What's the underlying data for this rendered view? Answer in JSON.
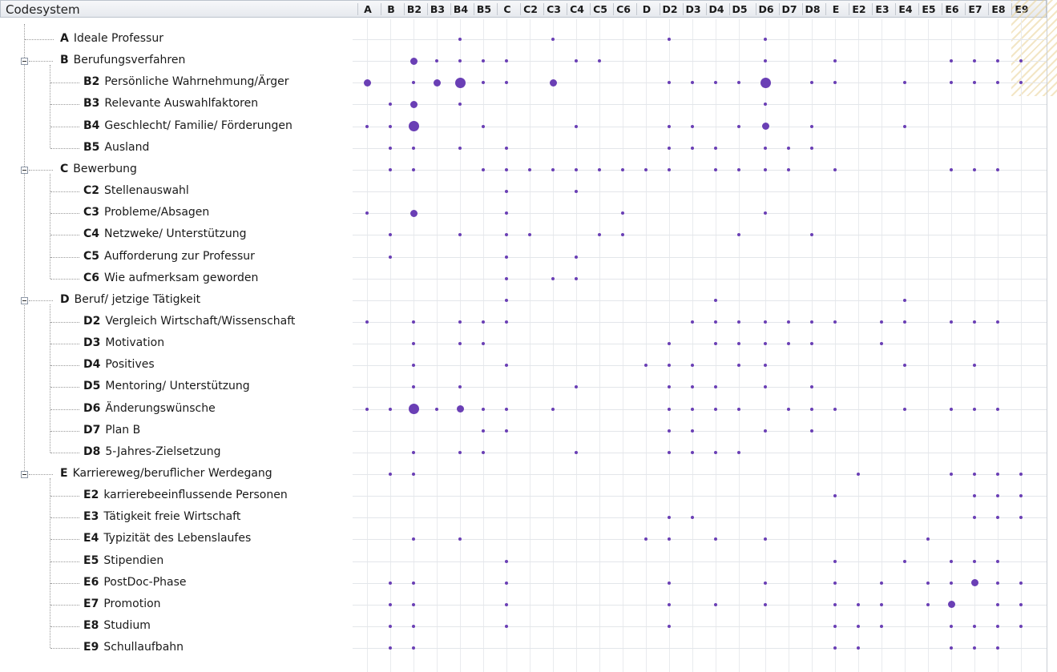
{
  "header": {
    "title": "Codesystem"
  },
  "columns": [
    "A",
    "B",
    "B2",
    "B3",
    "B4",
    "B5",
    "C",
    "C2",
    "C3",
    "C4",
    "C5",
    "C6",
    "D",
    "D2",
    "D3",
    "D4",
    "D5",
    "D6",
    "D7",
    "D8",
    "E",
    "E2",
    "E3",
    "E4",
    "E5",
    "E6",
    "E7",
    "E8",
    "E9"
  ],
  "rows": [
    {
      "code": "A",
      "label": "Ideale Professur",
      "level": 0,
      "expandable": false
    },
    {
      "code": "B",
      "label": "Berufungsverfahren",
      "level": 0,
      "expandable": true
    },
    {
      "code": "B2",
      "label": "Persönliche Wahrnehmung/Ärger",
      "level": 1
    },
    {
      "code": "B3",
      "label": "Relevante Auswahlfaktoren",
      "level": 1
    },
    {
      "code": "B4",
      "label": "Geschlecht/ Familie/ Förderungen",
      "level": 1
    },
    {
      "code": "B5",
      "label": "Ausland",
      "level": 1
    },
    {
      "code": "C",
      "label": "Bewerbung",
      "level": 0,
      "expandable": true
    },
    {
      "code": "C2",
      "label": "Stellenauswahl",
      "level": 1
    },
    {
      "code": "C3",
      "label": "Probleme/Absagen",
      "level": 1
    },
    {
      "code": "C4",
      "label": "Netzweke/ Unterstützung",
      "level": 1
    },
    {
      "code": "C5",
      "label": "Aufforderung zur Professur",
      "level": 1
    },
    {
      "code": "C6",
      "label": "Wie aufmerksam geworden",
      "level": 1
    },
    {
      "code": "D",
      "label": "Beruf/ jetzige Tätigkeit",
      "level": 0,
      "expandable": true
    },
    {
      "code": "D2",
      "label": "Vergleich Wirtschaft/Wissenschaft",
      "level": 1
    },
    {
      "code": "D3",
      "label": "Motivation",
      "level": 1
    },
    {
      "code": "D4",
      "label": "Positives",
      "level": 1
    },
    {
      "code": "D5",
      "label": "Mentoring/ Unterstützung",
      "level": 1
    },
    {
      "code": "D6",
      "label": "Änderungswünsche",
      "level": 1
    },
    {
      "code": "D7",
      "label": "Plan B",
      "level": 1
    },
    {
      "code": "D8",
      "label": "5-Jahres-Zielsetzung",
      "level": 1
    },
    {
      "code": "E",
      "label": "Karriereweg/beruflicher Werdegang",
      "level": 0,
      "expandable": true
    },
    {
      "code": "E2",
      "label": "karrierebeeinflussende  Personen",
      "level": 1
    },
    {
      "code": "E3",
      "label": "Tätigkeit freie Wirtschaft",
      "level": 1
    },
    {
      "code": "E4",
      "label": "Typizität des Lebenslaufes",
      "level": 1
    },
    {
      "code": "E5",
      "label": "Stipendien",
      "level": 1
    },
    {
      "code": "E6",
      "label": "PostDoc-Phase",
      "level": 1
    },
    {
      "code": "E7",
      "label": "Promotion",
      "level": 1
    },
    {
      "code": "E8",
      "label": "Studium",
      "level": 1
    },
    {
      "code": "E9",
      "label": "Schullaufbahn",
      "level": 1
    }
  ],
  "matrix": [
    [
      0,
      0,
      0,
      0,
      1,
      0,
      0,
      0,
      1,
      0,
      0,
      0,
      0,
      1,
      0,
      0,
      0,
      1,
      0,
      0,
      0,
      0,
      0,
      0,
      0,
      0,
      0,
      0,
      0
    ],
    [
      0,
      0,
      2,
      1,
      1,
      1,
      1,
      0,
      0,
      1,
      1,
      0,
      0,
      0,
      0,
      0,
      0,
      1,
      0,
      0,
      1,
      0,
      0,
      0,
      0,
      1,
      1,
      1,
      1
    ],
    [
      2,
      0,
      1,
      2,
      3,
      1,
      1,
      0,
      2,
      0,
      0,
      0,
      0,
      1,
      1,
      1,
      1,
      3,
      0,
      1,
      1,
      0,
      0,
      1,
      0,
      1,
      1,
      1,
      1
    ],
    [
      0,
      1,
      2,
      0,
      1,
      0,
      0,
      0,
      0,
      0,
      0,
      0,
      0,
      0,
      0,
      0,
      0,
      1,
      0,
      0,
      0,
      0,
      0,
      0,
      0,
      0,
      0,
      0,
      0
    ],
    [
      1,
      1,
      3,
      0,
      0,
      1,
      0,
      0,
      0,
      1,
      0,
      0,
      0,
      1,
      1,
      0,
      1,
      2,
      0,
      1,
      0,
      0,
      0,
      1,
      0,
      0,
      0,
      0,
      0
    ],
    [
      0,
      1,
      1,
      0,
      1,
      0,
      1,
      0,
      0,
      0,
      0,
      0,
      0,
      1,
      1,
      1,
      0,
      1,
      1,
      1,
      0,
      0,
      0,
      0,
      0,
      0,
      0,
      0,
      0
    ],
    [
      0,
      1,
      1,
      0,
      0,
      1,
      1,
      1,
      1,
      1,
      1,
      1,
      1,
      1,
      0,
      1,
      1,
      1,
      1,
      0,
      1,
      0,
      0,
      0,
      0,
      1,
      1,
      1,
      0
    ],
    [
      0,
      0,
      0,
      0,
      0,
      0,
      1,
      0,
      0,
      1,
      0,
      0,
      0,
      0,
      0,
      0,
      0,
      0,
      0,
      0,
      0,
      0,
      0,
      0,
      0,
      0,
      0,
      0,
      0
    ],
    [
      1,
      0,
      2,
      0,
      0,
      0,
      1,
      0,
      0,
      0,
      0,
      1,
      0,
      0,
      0,
      0,
      0,
      1,
      0,
      0,
      0,
      0,
      0,
      0,
      0,
      0,
      0,
      0,
      0
    ],
    [
      0,
      1,
      0,
      0,
      1,
      0,
      1,
      1,
      0,
      0,
      1,
      1,
      0,
      0,
      0,
      0,
      1,
      0,
      0,
      1,
      0,
      0,
      0,
      0,
      0,
      0,
      0,
      0,
      0
    ],
    [
      0,
      1,
      0,
      0,
      0,
      0,
      1,
      0,
      0,
      1,
      0,
      0,
      0,
      0,
      0,
      0,
      0,
      0,
      0,
      0,
      0,
      0,
      0,
      0,
      0,
      0,
      0,
      0,
      0
    ],
    [
      0,
      0,
      0,
      0,
      0,
      0,
      1,
      0,
      1,
      1,
      0,
      0,
      0,
      0,
      0,
      0,
      0,
      0,
      0,
      0,
      0,
      0,
      0,
      0,
      0,
      0,
      0,
      0,
      0
    ],
    [
      0,
      0,
      0,
      0,
      0,
      0,
      1,
      0,
      0,
      0,
      0,
      0,
      0,
      0,
      0,
      1,
      0,
      0,
      0,
      0,
      0,
      0,
      0,
      1,
      0,
      0,
      0,
      0,
      0
    ],
    [
      1,
      0,
      1,
      0,
      1,
      1,
      1,
      0,
      0,
      0,
      0,
      0,
      0,
      0,
      1,
      1,
      1,
      1,
      1,
      1,
      1,
      0,
      1,
      1,
      0,
      1,
      1,
      1,
      0
    ],
    [
      0,
      0,
      1,
      0,
      1,
      1,
      0,
      0,
      0,
      0,
      0,
      0,
      0,
      1,
      0,
      1,
      1,
      1,
      1,
      1,
      0,
      0,
      1,
      0,
      0,
      0,
      0,
      0,
      0
    ],
    [
      0,
      0,
      1,
      0,
      0,
      0,
      1,
      0,
      0,
      0,
      0,
      0,
      1,
      1,
      1,
      0,
      1,
      1,
      0,
      0,
      0,
      0,
      0,
      1,
      0,
      0,
      1,
      0,
      0
    ],
    [
      0,
      0,
      1,
      0,
      1,
      0,
      0,
      0,
      0,
      1,
      0,
      0,
      0,
      1,
      1,
      1,
      0,
      1,
      0,
      1,
      0,
      0,
      0,
      0,
      0,
      0,
      0,
      0,
      0
    ],
    [
      1,
      1,
      3,
      1,
      2,
      1,
      1,
      0,
      1,
      0,
      0,
      0,
      0,
      1,
      1,
      1,
      1,
      0,
      1,
      1,
      1,
      0,
      0,
      1,
      0,
      1,
      1,
      1,
      0
    ],
    [
      0,
      0,
      0,
      0,
      0,
      1,
      1,
      0,
      0,
      0,
      0,
      0,
      0,
      1,
      1,
      0,
      0,
      1,
      0,
      1,
      0,
      0,
      0,
      0,
      0,
      0,
      0,
      0,
      0
    ],
    [
      0,
      0,
      1,
      0,
      1,
      1,
      0,
      0,
      0,
      1,
      0,
      0,
      0,
      1,
      1,
      1,
      1,
      0,
      0,
      0,
      0,
      0,
      0,
      0,
      0,
      0,
      0,
      0,
      0
    ],
    [
      0,
      1,
      1,
      0,
      0,
      0,
      0,
      0,
      0,
      0,
      0,
      0,
      0,
      0,
      0,
      0,
      0,
      0,
      0,
      0,
      0,
      1,
      0,
      0,
      0,
      1,
      1,
      1,
      1
    ],
    [
      0,
      0,
      0,
      0,
      0,
      0,
      0,
      0,
      0,
      0,
      0,
      0,
      0,
      0,
      0,
      0,
      0,
      0,
      0,
      0,
      1,
      0,
      0,
      0,
      0,
      0,
      1,
      1,
      1
    ],
    [
      0,
      0,
      0,
      0,
      0,
      0,
      0,
      0,
      0,
      0,
      0,
      0,
      0,
      1,
      1,
      0,
      0,
      0,
      0,
      0,
      0,
      0,
      0,
      0,
      0,
      0,
      1,
      1,
      1
    ],
    [
      0,
      0,
      1,
      0,
      1,
      0,
      0,
      0,
      0,
      0,
      0,
      0,
      1,
      1,
      0,
      1,
      0,
      1,
      0,
      0,
      0,
      0,
      0,
      0,
      1,
      0,
      0,
      0,
      0
    ],
    [
      0,
      0,
      0,
      0,
      0,
      0,
      1,
      0,
      0,
      0,
      0,
      0,
      0,
      0,
      0,
      0,
      0,
      0,
      0,
      0,
      1,
      0,
      0,
      1,
      0,
      1,
      1,
      1,
      0
    ],
    [
      0,
      1,
      1,
      0,
      0,
      0,
      1,
      0,
      0,
      0,
      0,
      0,
      0,
      1,
      0,
      0,
      0,
      1,
      0,
      0,
      1,
      0,
      1,
      0,
      1,
      1,
      2,
      1,
      1
    ],
    [
      0,
      1,
      1,
      0,
      0,
      0,
      1,
      0,
      0,
      0,
      0,
      0,
      0,
      1,
      0,
      1,
      0,
      1,
      0,
      0,
      1,
      1,
      1,
      0,
      1,
      2,
      0,
      1,
      1
    ],
    [
      0,
      1,
      1,
      0,
      0,
      0,
      1,
      0,
      0,
      0,
      0,
      0,
      0,
      1,
      0,
      0,
      0,
      0,
      0,
      0,
      1,
      1,
      1,
      0,
      0,
      1,
      1,
      1,
      1
    ],
    [
      0,
      1,
      1,
      0,
      0,
      0,
      0,
      0,
      0,
      0,
      0,
      0,
      0,
      0,
      0,
      0,
      0,
      0,
      0,
      0,
      1,
      1,
      0,
      0,
      0,
      1,
      1,
      1,
      0
    ]
  ],
  "colors": {
    "dot": "#6a3fb5",
    "header_bg": "#eef0f3"
  }
}
